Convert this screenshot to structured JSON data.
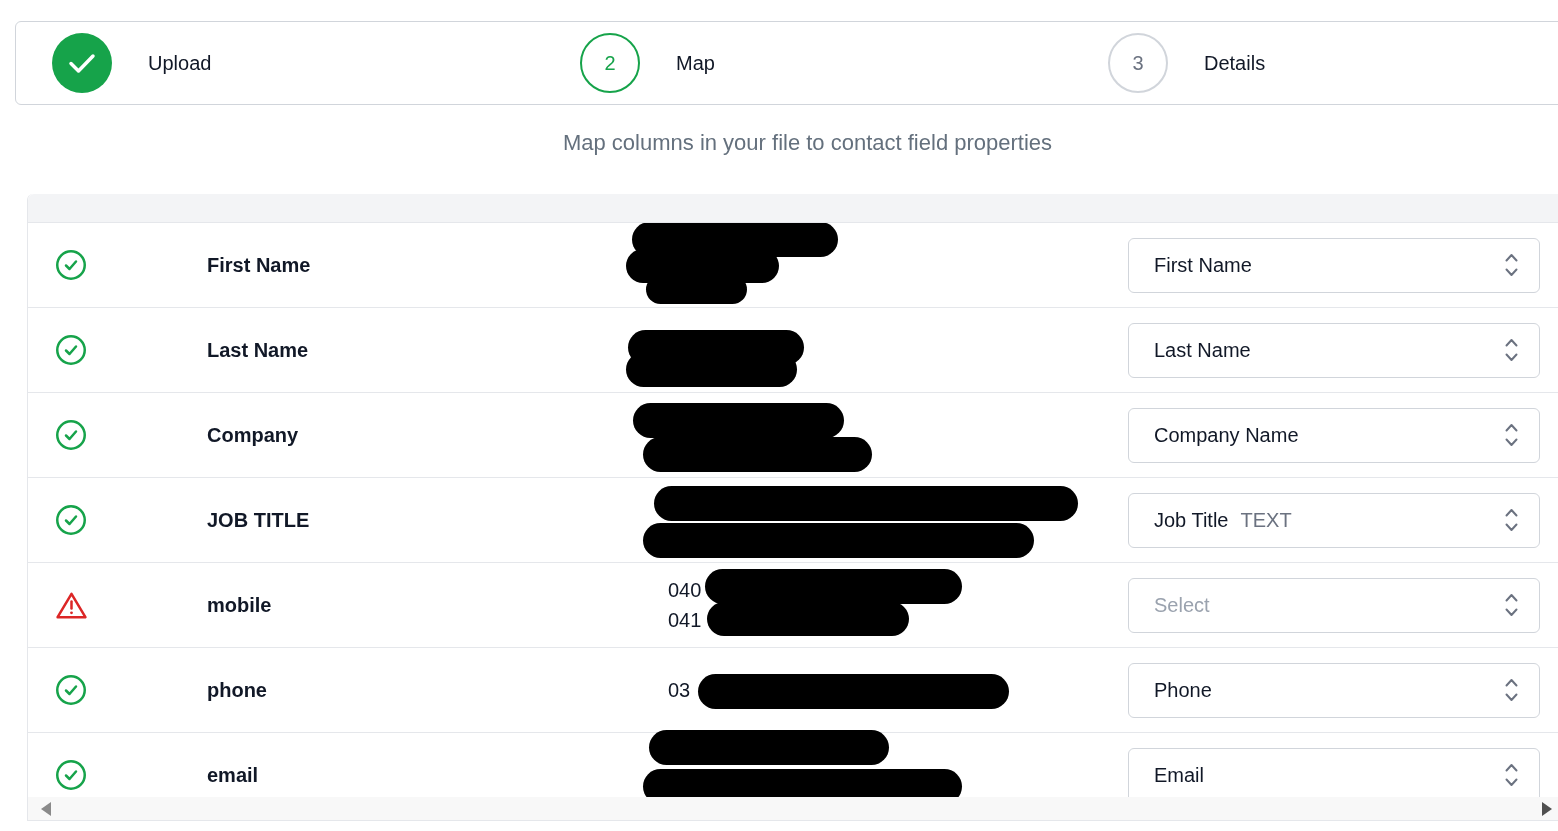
{
  "steps": [
    {
      "label": "Upload",
      "completed": true,
      "selected": false
    },
    {
      "number": "2",
      "label": "Map",
      "completed": false,
      "selected": true
    },
    {
      "number": "3",
      "label": "Details",
      "completed": false,
      "selected": false
    }
  ],
  "subtitle": "Map columns in your file to contact field properties",
  "mapping_table": {
    "rows": [
      {
        "mapped": true,
        "column": "First Name",
        "samples": [
          {
            "redacted": true
          },
          {
            "redacted": true
          },
          {
            "redacted": true
          }
        ],
        "field": {
          "value": "First Name"
        }
      },
      {
        "mapped": true,
        "column": "Last Name",
        "samples": [
          {
            "redacted": true
          },
          {
            "redacted": true
          }
        ],
        "field": {
          "value": "Last Name"
        }
      },
      {
        "mapped": true,
        "column": "Company",
        "samples": [
          {
            "redacted": true
          },
          {
            "redacted": true
          }
        ],
        "field": {
          "value": "Company Name"
        }
      },
      {
        "mapped": true,
        "column": "JOB TITLE",
        "samples": [
          {
            "redacted": true
          },
          {
            "redacted": true
          }
        ],
        "field": {
          "value": "Job Title",
          "type_tag": "TEXT"
        }
      },
      {
        "mapped": false,
        "column": "mobile",
        "samples": [
          {
            "text": "040",
            "redacted": true
          },
          {
            "text": "041",
            "redacted": true
          }
        ],
        "field": {
          "placeholder": "Select"
        }
      },
      {
        "mapped": true,
        "column": "phone",
        "samples": [
          {
            "text": "03",
            "redacted": true
          }
        ],
        "field": {
          "value": "Phone"
        }
      },
      {
        "mapped": true,
        "column": "email",
        "samples": [
          {
            "redacted": true
          },
          {
            "redacted": true
          }
        ],
        "field": {
          "value": "Email"
        }
      }
    ]
  }
}
